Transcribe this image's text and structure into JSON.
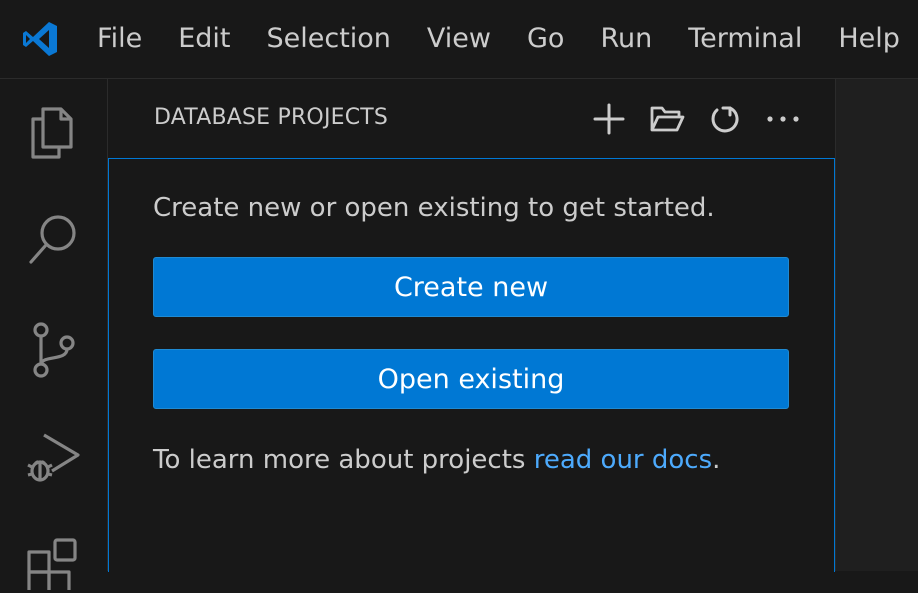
{
  "menubar": {
    "logo_icon": "vscode-logo-icon",
    "items": [
      "File",
      "Edit",
      "Selection",
      "View",
      "Go",
      "Run",
      "Terminal",
      "Help"
    ]
  },
  "activitybar": {
    "icons": [
      "explorer-icon",
      "search-icon",
      "source-control-icon",
      "run-debug-icon",
      "extensions-icon"
    ]
  },
  "sidebar": {
    "title": "DATABASE PROJECTS",
    "actions": [
      "add-icon",
      "open-folder-icon",
      "refresh-icon",
      "more-actions-icon"
    ],
    "welcome_text": "Create new or open existing to get started.",
    "create_button": "Create new",
    "open_button": "Open existing",
    "docs_prefix": "To learn more about projects ",
    "docs_link": "read our docs",
    "docs_suffix": "."
  },
  "colors": {
    "accent": "#0078d4",
    "link": "#4daafc",
    "background": "#181818",
    "logo": "#0a78d4"
  }
}
